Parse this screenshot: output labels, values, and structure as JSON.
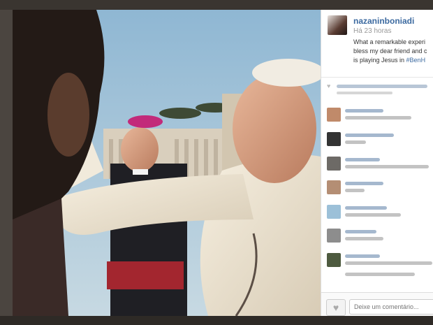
{
  "post": {
    "username": "nazaninboniadi",
    "time_ago": "Há 23 horas",
    "caption_lines": [
      "What a remarkable experi",
      "bless my dear friend and c",
      "is playing Jesus in "
    ],
    "caption_hashtag": "#BenH"
  },
  "comments": [
    {
      "avatar_color": "#c08a6a"
    },
    {
      "avatar_color": "#333333"
    },
    {
      "avatar_color": "#6d6a66"
    },
    {
      "avatar_color": "#b48e74"
    },
    {
      "avatar_color": "#9cc0d8"
    },
    {
      "avatar_color": "#8d8d8d"
    },
    {
      "avatar_color": "#4d5a3f"
    }
  ],
  "footer": {
    "like_icon": "heart-icon",
    "comment_placeholder": "Deixe um comentário..."
  },
  "colors": {
    "link": "#3c6aa0",
    "sky": "#9dc0d6"
  }
}
